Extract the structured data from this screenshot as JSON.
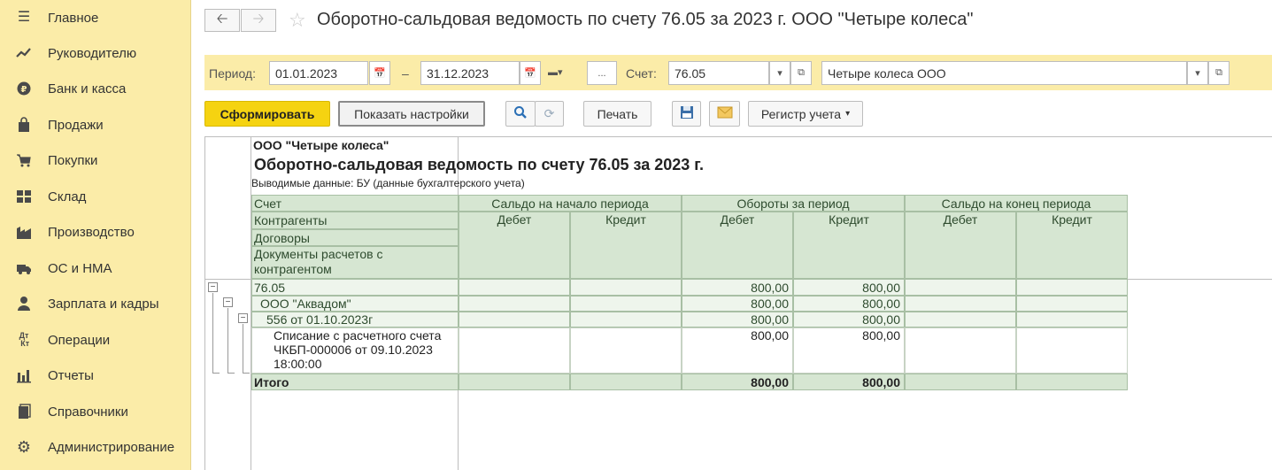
{
  "sidebar": {
    "items": [
      {
        "label": "Главное",
        "icon": "menu-icon"
      },
      {
        "label": "Руководителю",
        "icon": "trend-icon"
      },
      {
        "label": "Банк и касса",
        "icon": "coin-icon"
      },
      {
        "label": "Продажи",
        "icon": "bag-icon"
      },
      {
        "label": "Покупки",
        "icon": "cart-icon"
      },
      {
        "label": "Склад",
        "icon": "warehouse-icon"
      },
      {
        "label": "Производство",
        "icon": "factory-icon"
      },
      {
        "label": "ОС и НМА",
        "icon": "truck-icon"
      },
      {
        "label": "Зарплата и кадры",
        "icon": "person-icon"
      },
      {
        "label": "Операции",
        "icon": "dt-kt-icon"
      },
      {
        "label": "Отчеты",
        "icon": "bar-chart-icon"
      },
      {
        "label": "Справочники",
        "icon": "books-icon"
      },
      {
        "label": "Администрирование",
        "icon": "gear-icon"
      }
    ]
  },
  "header": {
    "title": "Оборотно-сальдовая ведомость по счету 76.05 за 2023 г. ООО \"Четыре колеса\""
  },
  "filters": {
    "period_label": "Период:",
    "date_from": "01.01.2023",
    "dash": "–",
    "date_to": "31.12.2023",
    "ellipsis": "...",
    "account_label": "Счет:",
    "account": "76.05",
    "org": "Четыре колеса ООО"
  },
  "toolbar": {
    "generate": "Сформировать",
    "settings": "Показать настройки",
    "print": "Печать",
    "register": "Регистр учета"
  },
  "report": {
    "org_name": "ООО \"Четыре колеса\"",
    "title": "Оборотно-сальдовая ведомость по счету 76.05 за 2023 г.",
    "subtitle": "Выводимые данные: БУ (данные бухгалтерского учета)",
    "col_account": "Счет",
    "col_contractors": "Контрагенты",
    "col_contracts": "Договоры",
    "col_docs": "Документы расчетов с контрагентом",
    "group_opening": "Сальдо на начало периода",
    "group_turnover": "Обороты за период",
    "group_closing": "Сальдо на конец периода",
    "debit": "Дебет",
    "credit": "Кредит",
    "rows": [
      {
        "name": "76.05",
        "turn_debit": "800,00",
        "turn_credit": "800,00"
      },
      {
        "name": "ООО \"Аквадом\"",
        "turn_debit": "800,00",
        "turn_credit": "800,00"
      },
      {
        "name": "556 от 01.10.2023г",
        "turn_debit": "800,00",
        "turn_credit": "800,00"
      },
      {
        "name_l1": "Списание с расчетного счета",
        "name_l2": "ЧКБП-000006 от 09.10.2023",
        "name_l3": "18:00:00",
        "turn_debit": "800,00",
        "turn_credit": "800,00"
      }
    ],
    "total": {
      "name": "Итого",
      "turn_debit": "800,00",
      "turn_credit": "800,00"
    }
  }
}
